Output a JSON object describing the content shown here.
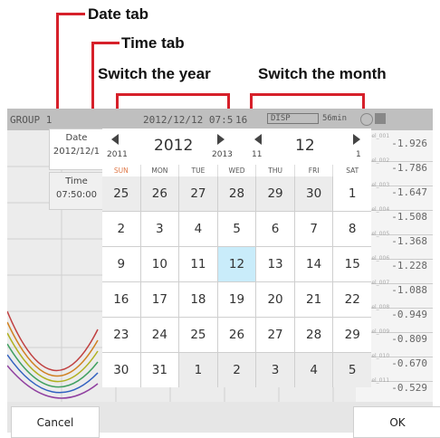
{
  "annotations": {
    "date_tab": "Date tab",
    "time_tab": "Time tab",
    "switch_year": "Switch the year",
    "switch_month": "Switch the month",
    "accent_color": "#d6202a"
  },
  "topbar": {
    "group": "GROUP 1",
    "datetime": "2012/12/12 07:5",
    "time_suffix": "16",
    "disp": "DISP",
    "span": "56min"
  },
  "readouts": [
    {
      "name": "anmel_001",
      "value": "-1.926"
    },
    {
      "name": "anmel_002",
      "value": "-1.786"
    },
    {
      "name": "anmel_003",
      "value": "-1.647"
    },
    {
      "name": "anmel_004",
      "value": "-1.508"
    },
    {
      "name": "anmel_005",
      "value": "-1.368"
    },
    {
      "name": "anmel_006",
      "value": "-1.228"
    },
    {
      "name": "anmel_007",
      "value": "-1.088"
    },
    {
      "name": "anmel_008",
      "value": "-0.949"
    },
    {
      "name": "anmel_009",
      "value": "-0.809"
    },
    {
      "name": "anmel_010",
      "value": "-0.670"
    },
    {
      "name": "anmel_011",
      "value": "-0.529"
    }
  ],
  "dialog": {
    "date_tab": {
      "title": "Date",
      "value": "2012/12/1"
    },
    "time_tab": {
      "title": "Time",
      "value": "07:50:00"
    },
    "year": {
      "prev": "2011",
      "current": "2012",
      "next": "2013"
    },
    "month": {
      "prev": "11",
      "current": "12",
      "next": "1"
    },
    "weekdays": [
      "SUN",
      "MON",
      "TUE",
      "WED",
      "THU",
      "FRI",
      "SAT"
    ],
    "weeks": [
      [
        "25",
        "26",
        "27",
        "28",
        "29",
        "30",
        "1"
      ],
      [
        "2",
        "3",
        "4",
        "5",
        "6",
        "7",
        "8"
      ],
      [
        "9",
        "10",
        "11",
        "12",
        "13",
        "14",
        "15"
      ],
      [
        "16",
        "17",
        "18",
        "19",
        "20",
        "21",
        "22"
      ],
      [
        "23",
        "24",
        "25",
        "26",
        "27",
        "28",
        "29"
      ],
      [
        "30",
        "31",
        "1",
        "2",
        "3",
        "4",
        "5"
      ]
    ],
    "selected_day": "12",
    "sunday_color": "#e07a4a",
    "selected_color": "#c9ecfa",
    "cancel": "Cancel",
    "ok": "OK"
  }
}
